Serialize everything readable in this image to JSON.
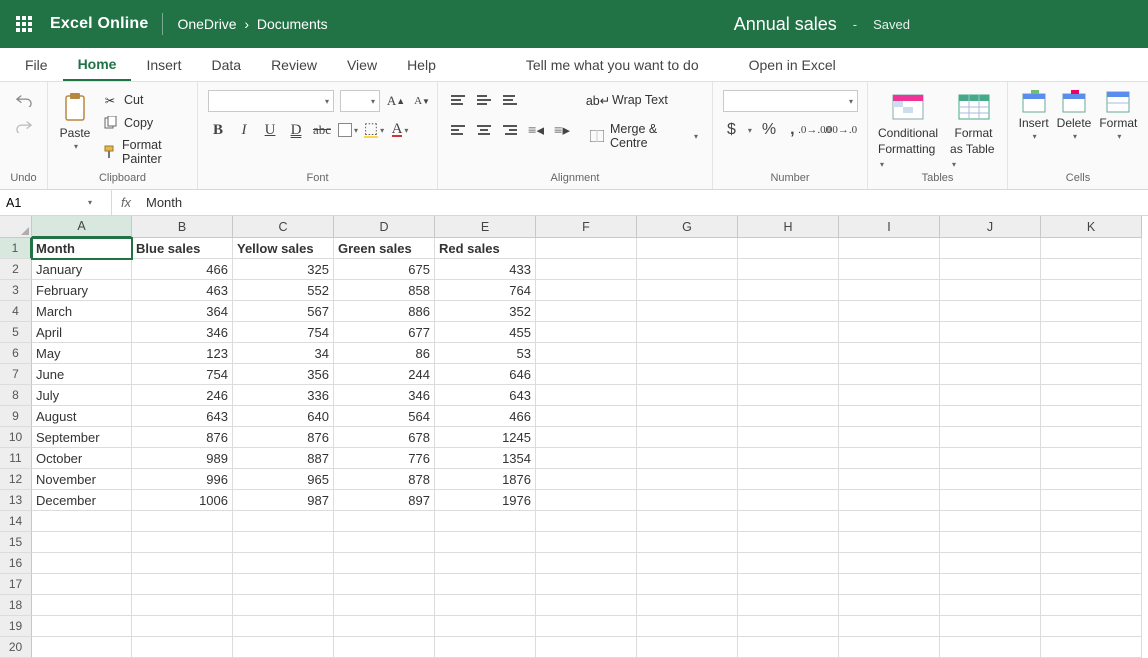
{
  "titlebar": {
    "app": "Excel Online",
    "crumb1": "OneDrive",
    "crumb_sep": "›",
    "crumb2": "Documents",
    "doc": "Annual sales",
    "dash": "-",
    "saved": "Saved"
  },
  "menu": {
    "file": "File",
    "home": "Home",
    "insert": "Insert",
    "data": "Data",
    "review": "Review",
    "view": "View",
    "help": "Help",
    "tellme": "Tell me what you want to do",
    "openexcel": "Open in Excel"
  },
  "ribbon": {
    "undo_label": "Undo",
    "paste_label": "Paste",
    "cut": "Cut",
    "copy": "Copy",
    "fmtpaint": "Format Painter",
    "clipboard": "Clipboard",
    "font_group": "Font",
    "bold": "B",
    "italic": "I",
    "uline": "U",
    "duline": "D",
    "strike": "abc",
    "grow": "A↑",
    "shrink": "A↓",
    "align_group": "Alignment",
    "wrap": "Wrap Text",
    "merge": "Merge & Centre",
    "number_group": "Number",
    "dollar": "$",
    "percent": "%",
    "comma": ",",
    "tables_group": "Tables",
    "cond": "Conditional",
    "cond2": "Formatting",
    "fmt_tbl": "Format",
    "fmt_tbl2": "as Table",
    "cells_group": "Cells",
    "insert_btn": "Insert",
    "delete_btn": "Delete",
    "format_btn": "Format"
  },
  "fbar": {
    "ref": "A1",
    "fx": "fx",
    "val": "Month"
  },
  "cols": [
    "A",
    "B",
    "C",
    "D",
    "E",
    "F",
    "G",
    "H",
    "I",
    "J",
    "K"
  ],
  "headers": [
    "Month",
    "Blue sales",
    "Yellow sales",
    "Green sales",
    "Red sales"
  ],
  "rows": [
    [
      "January",
      466,
      325,
      675,
      433
    ],
    [
      "February",
      463,
      552,
      858,
      764
    ],
    [
      "March",
      364,
      567,
      886,
      352
    ],
    [
      "April",
      346,
      754,
      677,
      455
    ],
    [
      "May",
      123,
      34,
      86,
      53
    ],
    [
      "June",
      754,
      356,
      244,
      646
    ],
    [
      "July",
      246,
      336,
      346,
      643
    ],
    [
      "August",
      643,
      640,
      564,
      466
    ],
    [
      "September",
      876,
      876,
      678,
      1245
    ],
    [
      "October",
      989,
      887,
      776,
      1354
    ],
    [
      "November",
      996,
      965,
      878,
      1876
    ],
    [
      "December",
      1006,
      987,
      897,
      1976
    ]
  ],
  "total_rows": 20
}
